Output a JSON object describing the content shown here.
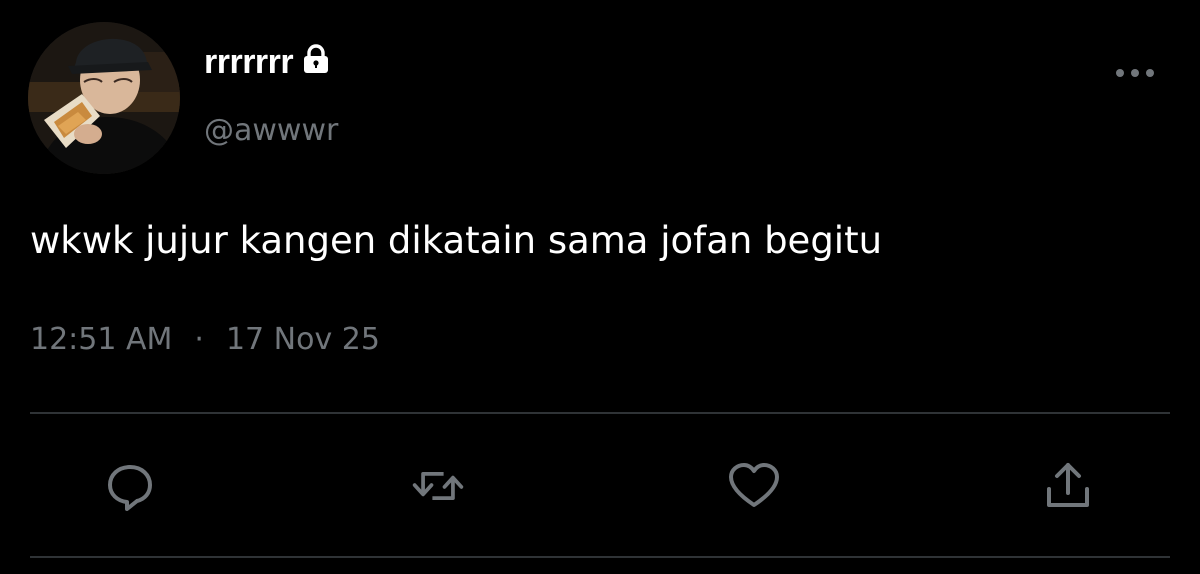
{
  "tweet": {
    "author": {
      "display_name": "rrrrrrr",
      "handle": "@awwwr",
      "protected_icon": "lock-icon",
      "avatar": "avatar-photo"
    },
    "text": "wkwk jujur kangen dikatain sama jofan begitu",
    "time": "12:51 AM",
    "separator": "·",
    "date": "17 Nov 25"
  },
  "actions": [
    {
      "name": "reply",
      "icon": "comment-icon"
    },
    {
      "name": "retweet",
      "icon": "retweet-icon"
    },
    {
      "name": "like",
      "icon": "heart-icon"
    },
    {
      "name": "share",
      "icon": "share-icon"
    }
  ],
  "colors": {
    "background": "#000000",
    "primary_text": "#ffffff",
    "secondary_text": "#71767b",
    "divider": "#2f3336"
  }
}
